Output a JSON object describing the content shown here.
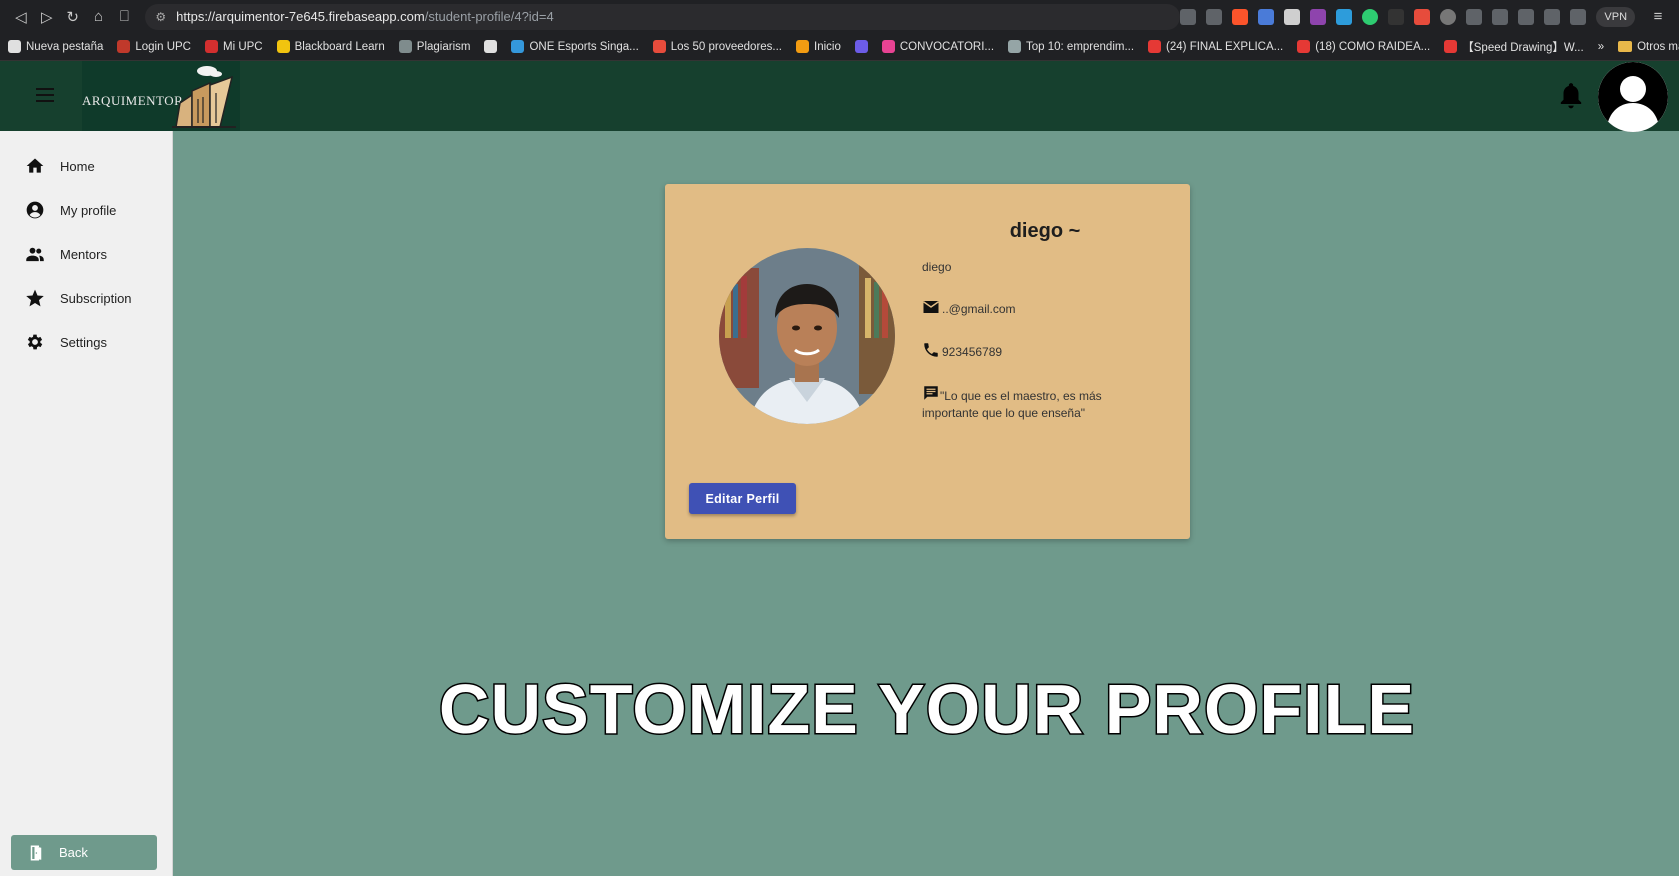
{
  "browser": {
    "url_host": "https://arquimentor-7e645.firebaseapp.com",
    "url_path": "/student-profile/4?id=4",
    "vpn_label": "VPN"
  },
  "bookmarks": [
    {
      "label": "Nueva pestaña",
      "color": "#e0e0e0"
    },
    {
      "label": "Login UPC",
      "color": "#c0392b"
    },
    {
      "label": "Mi UPC",
      "color": "#d32f2f"
    },
    {
      "label": "Blackboard Learn",
      "color": "#f1c40f"
    },
    {
      "label": "Plagiarism",
      "color": "#7f8c8d"
    },
    {
      "label": "",
      "color": "#e0e0e0"
    },
    {
      "label": "ONE Esports Singa...",
      "color": "#3498db"
    },
    {
      "label": "Los 50 proveedores...",
      "color": "#e74c3c"
    },
    {
      "label": "Inicio",
      "color": "#f39c12"
    },
    {
      "label": "",
      "color": "#6c5ce7"
    },
    {
      "label": "CONVOCATORI...",
      "color": "#e84393"
    },
    {
      "label": "Top 10: emprendim...",
      "color": "#95a5a6"
    },
    {
      "label": "(24) FINAL EXPLICA...",
      "color": "#e53935"
    },
    {
      "label": "(18) COMO RAIDEA...",
      "color": "#e53935"
    },
    {
      "label": "【Speed Drawing】W...",
      "color": "#e53935"
    }
  ],
  "bookmarks_more": "»",
  "bookmarks_folder": "Otros marcadores",
  "app": {
    "logo_text": "ARQUIMENTOR"
  },
  "sidebar": {
    "items": [
      {
        "label": "Home",
        "icon": "home-icon"
      },
      {
        "label": "My profile",
        "icon": "account-circle-icon"
      },
      {
        "label": "Mentors",
        "icon": "people-icon"
      },
      {
        "label": "Subscription",
        "icon": "star-icon"
      },
      {
        "label": "Settings",
        "icon": "gear-icon"
      }
    ],
    "back_label": "Back"
  },
  "profile": {
    "title": "diego ~",
    "name": "diego",
    "email": "..@gmail.com",
    "phone": "923456789",
    "quote": "\"Lo que es el maestro, es más importante que lo que enseña\"",
    "edit_label": "Editar Perfil"
  },
  "caption": "CUSTOMIZE YOUR PROFILE",
  "colors": {
    "header": "#16402e",
    "background": "#6f9a8c",
    "card": "#e1bc85",
    "button": "#3f51b5"
  }
}
